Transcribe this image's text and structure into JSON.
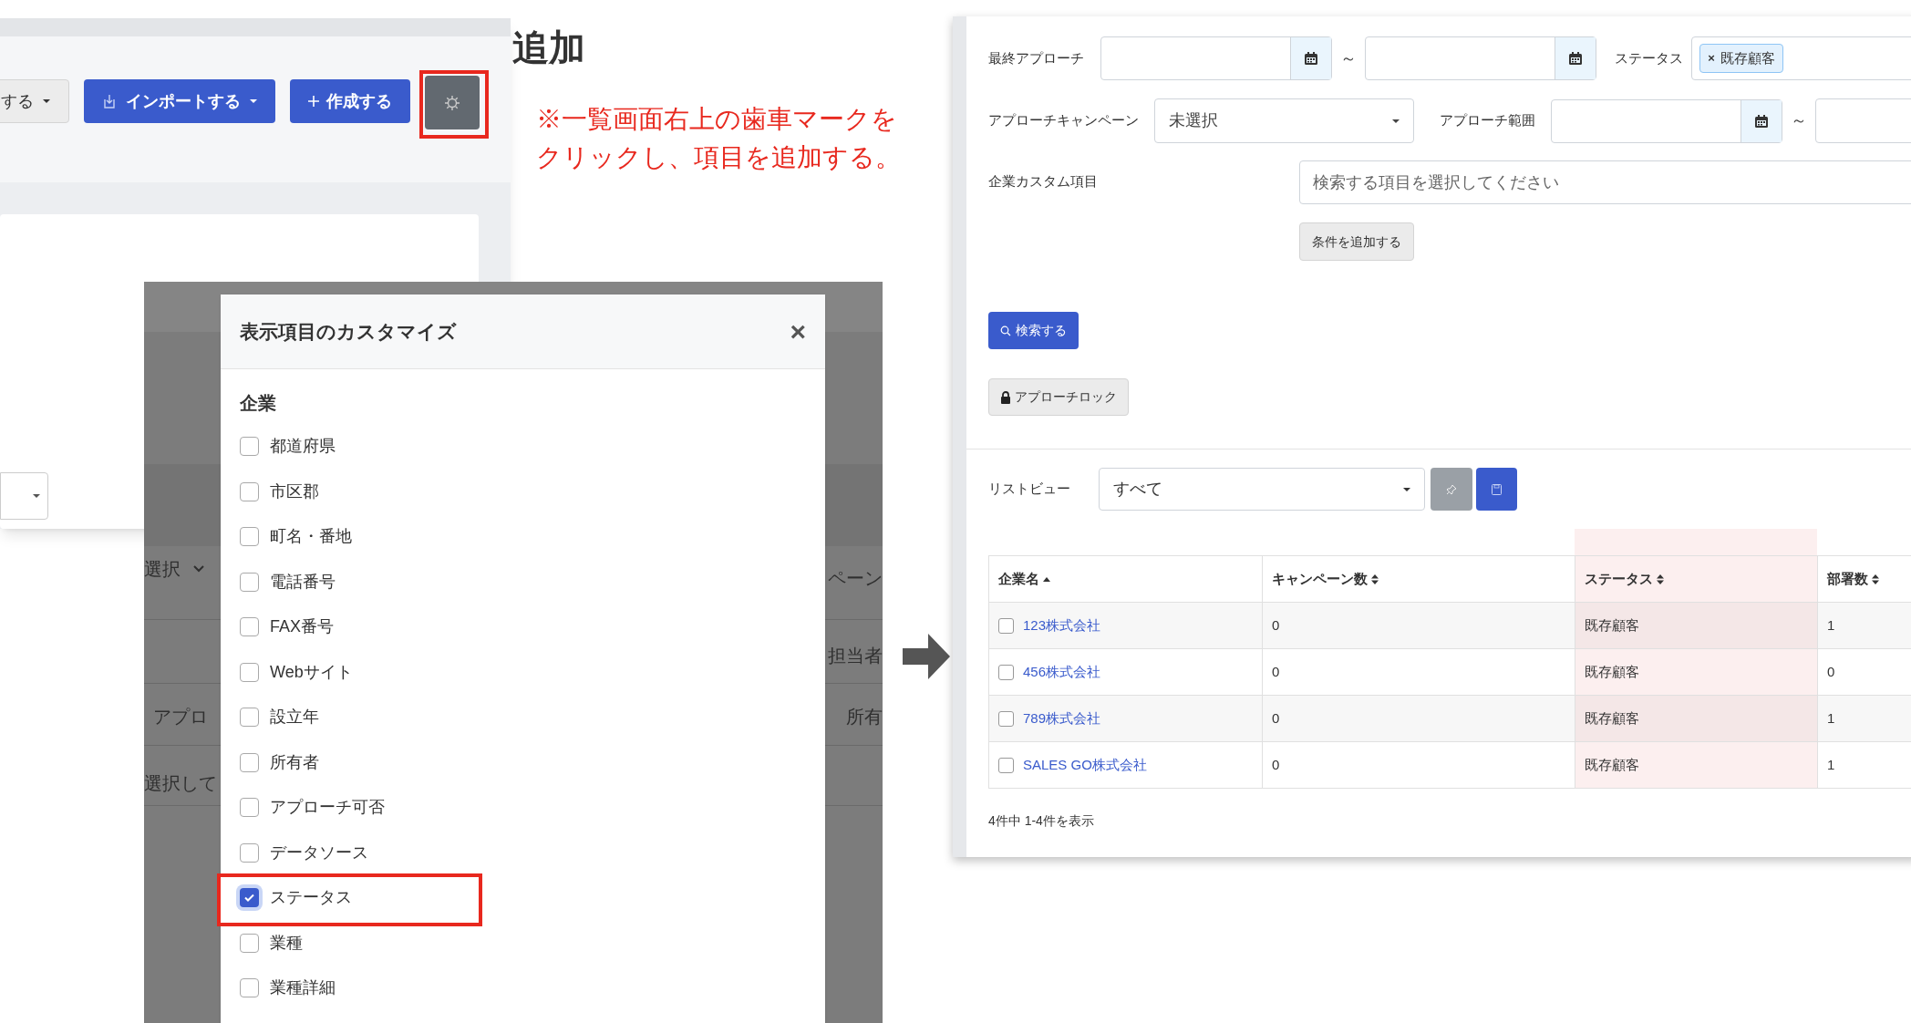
{
  "heading": "追加",
  "note_lines": [
    "※一覧画面右上の歯車マークを",
    "クリックし、項目を追加する。"
  ],
  "left_screen": {
    "buttons": [
      {
        "kind": "dropdown",
        "label": "する"
      },
      {
        "kind": "import",
        "label": "インポートする"
      },
      {
        "kind": "create",
        "label": "作成する"
      },
      {
        "kind": "settings",
        "highlighted": true
      }
    ]
  },
  "modal": {
    "background_texts": [
      {
        "kind": "select",
        "text": "選択"
      },
      {
        "kind": "plain",
        "text": "ペーン"
      },
      {
        "kind": "plain",
        "text": "担当者"
      },
      {
        "kind": "plain",
        "text": "アプロ"
      },
      {
        "kind": "plain",
        "text": "所有"
      },
      {
        "kind": "plain",
        "text": "選択して"
      }
    ],
    "title": "表示項目のカスタマイズ",
    "close": "×",
    "section": "企業",
    "options": [
      {
        "label": "都道府県",
        "checked": false,
        "highlighted": false
      },
      {
        "label": "市区郡",
        "checked": false,
        "highlighted": false
      },
      {
        "label": "町名・番地",
        "checked": false,
        "highlighted": false
      },
      {
        "label": "電話番号",
        "checked": false,
        "highlighted": false
      },
      {
        "label": "FAX番号",
        "checked": false,
        "highlighted": false
      },
      {
        "label": "Webサイト",
        "checked": false,
        "highlighted": false
      },
      {
        "label": "設立年",
        "checked": false,
        "highlighted": false
      },
      {
        "label": "所有者",
        "checked": false,
        "highlighted": false
      },
      {
        "label": "アプローチ可否",
        "checked": false,
        "highlighted": false
      },
      {
        "label": "データソース",
        "checked": false,
        "highlighted": false
      },
      {
        "label": "ステータス",
        "checked": true,
        "highlighted": true
      },
      {
        "label": "業種",
        "checked": false,
        "highlighted": false
      },
      {
        "label": "業種詳細",
        "checked": false,
        "highlighted": false
      }
    ]
  },
  "right_screen": {
    "last_approach": {
      "label": "最終アプローチ",
      "tilde": "～"
    },
    "status_filter": {
      "label": "ステータス",
      "tags": [
        {
          "remove": "×",
          "text": "既存顧客"
        }
      ]
    },
    "campaign": {
      "label": "アプローチキャンペーン",
      "value": "未選択"
    },
    "approach_range": {
      "label": "アプローチ範囲",
      "tilde": "～"
    },
    "custom": {
      "label": "企業カスタム項目",
      "placeholder": "検索する項目を選択してください",
      "add_button": "条件を追加する"
    },
    "search_button": "検索する",
    "lock_button": "アプローチロック",
    "list_view": {
      "label": "リストビュー",
      "value": "すべて"
    },
    "table": {
      "columns": [
        {
          "label": "企業名",
          "sorted": true,
          "highlighted": false
        },
        {
          "label": "キャンペーン数",
          "sorted": false,
          "highlighted": false
        },
        {
          "label": "ステータス",
          "sorted": false,
          "highlighted": true
        },
        {
          "label": "部署数",
          "sorted": false,
          "highlighted": false
        }
      ],
      "rows": [
        {
          "checked": false,
          "company": "123株式会社",
          "campaigns": "0",
          "status": "既存顧客",
          "departments": "1"
        },
        {
          "checked": false,
          "company": "456株式会社",
          "campaigns": "0",
          "status": "既存顧客",
          "departments": "0"
        },
        {
          "checked": false,
          "company": "789株式会社",
          "campaigns": "0",
          "status": "既存顧客",
          "departments": "1"
        },
        {
          "checked": false,
          "company": "SALES GO株式会社",
          "campaigns": "0",
          "status": "既存顧客",
          "departments": "1"
        }
      ]
    },
    "summary": "4件中 1-4件を表示"
  }
}
